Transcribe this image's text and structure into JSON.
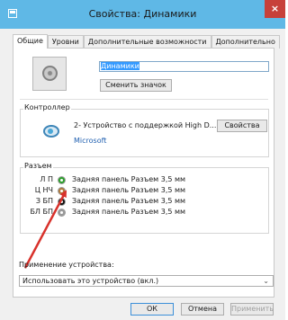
{
  "window": {
    "title": "Свойства: Динамики",
    "close_symbol": "×",
    "title_icon": "window-icon"
  },
  "tabs": [
    {
      "label": "Общие",
      "active": true
    },
    {
      "label": "Уровни",
      "active": false
    },
    {
      "label": "Дополнительные возможности",
      "active": false
    },
    {
      "label": "Дополнительно",
      "active": false
    }
  ],
  "general": {
    "device_icon": "speaker-icon",
    "name_value": "Динамики",
    "change_icon_label": "Сменить значок"
  },
  "controller": {
    "label": "Контроллер",
    "icon": "audio-device-icon",
    "device_name": "2- Устройство с поддержкой High D...",
    "vendor": "Microsoft",
    "properties_label": "Свойства"
  },
  "jacks": {
    "label": "Разъем",
    "rows": [
      {
        "code": "Л П",
        "color": "#2ca02c",
        "text": "Задняя панель Разъем 3,5 мм"
      },
      {
        "code": "Ц НЧ",
        "color": "#b07a3c",
        "text": "Задняя панель Разъем 3,5 мм"
      },
      {
        "code": "З БП",
        "color": "#111111",
        "text": "Задняя панель Разъем 3,5 мм"
      },
      {
        "code": "БЛ БП",
        "color": "#9a9a9a",
        "text": "Задняя панель Разъем 3,5 мм"
      }
    ]
  },
  "annotation": {
    "arrow_color": "#d8312b"
  },
  "usage": {
    "label": "Применение устройства:",
    "selected": "Использовать это устройство (вкл.)",
    "chevron": "⌄"
  },
  "buttons": {
    "ok": "ОК",
    "cancel": "Отмена",
    "apply": "Применить"
  },
  "colors": {
    "title_bar": "#5fb8e6",
    "close_button": "#c7403a",
    "selection": "#3399ff",
    "link": "#1f5fb0"
  }
}
